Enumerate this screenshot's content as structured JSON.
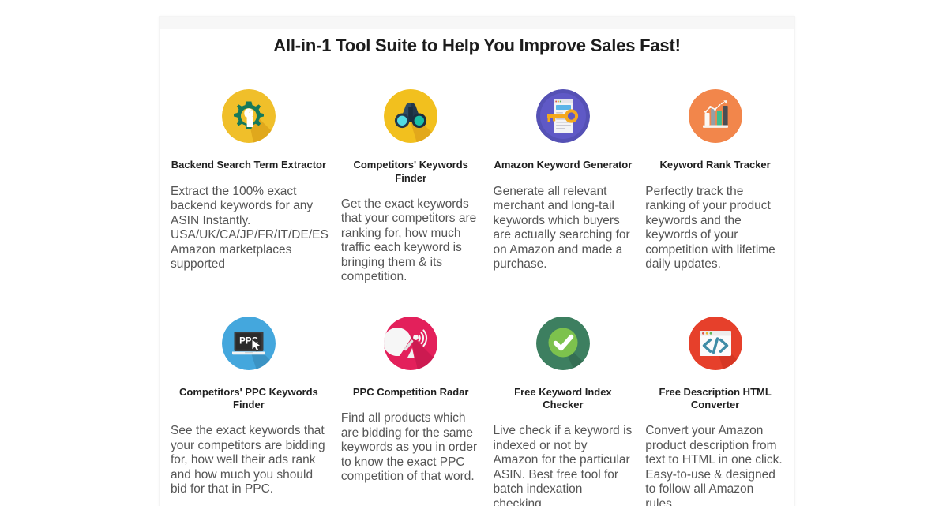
{
  "page": {
    "background": "#ffffff",
    "panel_background": "#ffffff"
  },
  "header": {
    "title": "All-in-1 Tool Suite to Help You Improve Sales Fast!"
  },
  "tools": [
    {
      "icon": "gear-wrench-icon",
      "icon_bg": "#f0bf2a",
      "name": "Backend Search Term Extractor",
      "description": "Extract the 100% exact backend keywords for any ASIN Instantly. USA/UK/CA/JP/FR/IT/DE/ES Amazon marketplaces supported"
    },
    {
      "icon": "binoculars-icon",
      "icon_bg": "#f2c01e",
      "name": "Competitors' Keywords Finder",
      "description": "Get the exact keywords that your competitors are ranking for, how much traffic each keyword is bringing them & its competition."
    },
    {
      "icon": "document-key-icon",
      "icon_bg": "#5551b5",
      "name": "Amazon Keyword Generator",
      "description": "Generate all relevant merchant and long-tail keywords which buyers are actually searching for on Amazon and made a purchase."
    },
    {
      "icon": "bar-chart-growth-icon",
      "icon_bg": "#f2864b",
      "name": "Keyword Rank Tracker",
      "description": "Perfectly track the ranking of your product keywords and the keywords of your competition with lifetime daily updates."
    },
    {
      "icon": "laptop-ppc-cursor-icon",
      "icon_bg": "#44a7dd",
      "name": "Competitors' PPC Keywords Finder",
      "description": "See the exact keywords that your competitors are bidding for, how well their ads rank and how much you should bid for that in PPC."
    },
    {
      "icon": "satellite-dish-icon",
      "icon_bg": "#e3205b",
      "name": "PPC Competition Radar",
      "description": "Find all products which are bidding for the same keywords as you in order to know the exact PPC competition of that word."
    },
    {
      "icon": "green-checkmark-icon",
      "icon_bg": "#3d7f60",
      "name": "Free Keyword Index Checker",
      "description": "Live check if a keyword is indexed or not by Amazon for the particular ASIN. Best free tool for batch indexation checking."
    },
    {
      "icon": "code-browser-icon",
      "icon_bg": "#e6402b",
      "name": "Free Description HTML Converter",
      "description": "Convert your Amazon product description from text to HTML in one click. Easy-to-use & designed to follow all Amazon rules."
    }
  ]
}
